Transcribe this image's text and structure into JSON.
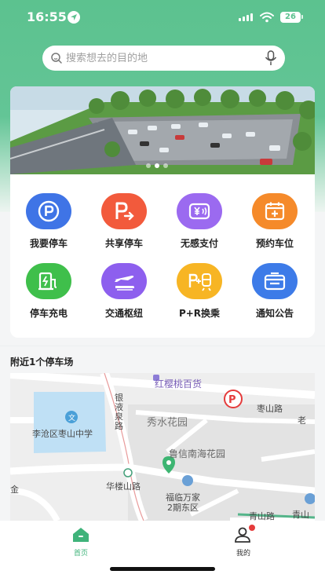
{
  "status_bar": {
    "time": "16:55",
    "battery": "26"
  },
  "search": {
    "placeholder": "搜索想去的目的地"
  },
  "banner": {
    "slides": 3,
    "active_slide": 1
  },
  "menu": [
    {
      "label": "我要停车",
      "icon": "parking-p-icon",
      "color": "#3f74e6"
    },
    {
      "label": "共享停车",
      "icon": "shared-parking-icon",
      "color": "#f25a3c"
    },
    {
      "label": "无感支付",
      "icon": "payment-card-icon",
      "color": "#9b6af0"
    },
    {
      "label": "预约车位",
      "icon": "calendar-plus-icon",
      "color": "#f58a2a"
    },
    {
      "label": "停车充电",
      "icon": "ev-charger-icon",
      "color": "#3fbf4b"
    },
    {
      "label": "交通枢纽",
      "icon": "plane-train-icon",
      "color": "#8d5fee"
    },
    {
      "label": "P+R换乘",
      "icon": "park-ride-icon",
      "color": "#f7b524"
    },
    {
      "label": "通知公告",
      "icon": "notice-envelope-icon",
      "color": "#3d7be8"
    }
  ],
  "nearby": {
    "title": "附近1个停车场"
  },
  "map": {
    "labels": {
      "store": "红樱桃百货",
      "zaoshan_road": "枣山路",
      "lao": "老",
      "xiushui": "秀水花园",
      "yinye": "银液泉路",
      "school": "李沧区枣山中学",
      "luxin": "鲁信南海花园",
      "hualou": "华楼山路",
      "fulin_1": "福临万家",
      "fulin_2": "2期东区",
      "qingshan_1": "青山路",
      "qingshan_2": "青山",
      "jin": "金"
    }
  },
  "tabbar": {
    "home": "首页",
    "mine": "我的"
  },
  "colors": {
    "brand": "#5cc28f",
    "active_tab": "#3fb37a"
  }
}
